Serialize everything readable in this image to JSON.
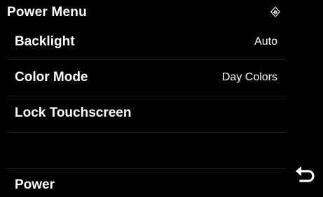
{
  "header": {
    "title": "Power Menu",
    "status_icon": "gps-compass-icon"
  },
  "menu": {
    "items": [
      {
        "label": "Backlight",
        "value": "Auto"
      },
      {
        "label": "Color Mode",
        "value": "Day Colors"
      },
      {
        "label": "Lock Touchscreen",
        "value": ""
      },
      {
        "label": "",
        "value": ""
      },
      {
        "label": "Power",
        "value": ""
      }
    ]
  },
  "controls": {
    "back_icon": "back-arrow-icon"
  },
  "colors": {
    "background": "#000000",
    "text": "#ffffff",
    "separator": "#1f1f1f"
  }
}
